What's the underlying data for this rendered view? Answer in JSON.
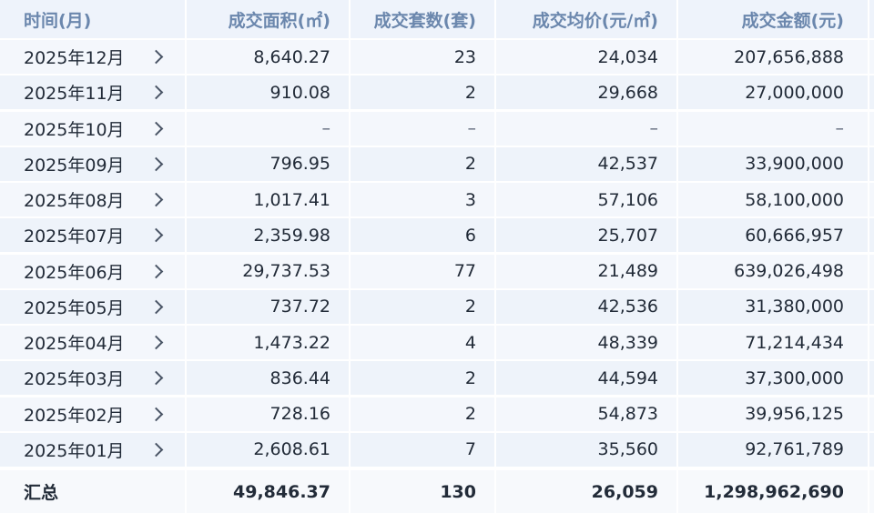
{
  "table": {
    "headers": [
      "时间(月)",
      "成交面积(㎡)",
      "成交套数(套)",
      "成交均价(元/㎡)",
      "成交金额(元)"
    ],
    "rows": [
      [
        "2025年12月",
        "8,640.27",
        "23",
        "24,034",
        "207,656,888"
      ],
      [
        "2025年11月",
        "910.08",
        "2",
        "29,668",
        "27,000,000"
      ],
      [
        "2025年10月",
        "–",
        "–",
        "–",
        "–"
      ],
      [
        "2025年09月",
        "796.95",
        "2",
        "42,537",
        "33,900,000"
      ],
      [
        "2025年08月",
        "1,017.41",
        "3",
        "57,106",
        "58,100,000"
      ],
      [
        "2025年07月",
        "2,359.98",
        "6",
        "25,707",
        "60,666,957"
      ],
      [
        "2025年06月",
        "29,737.53",
        "77",
        "21,489",
        "639,026,498"
      ],
      [
        "2025年05月",
        "737.72",
        "2",
        "42,536",
        "31,380,000"
      ],
      [
        "2025年04月",
        "1,473.22",
        "4",
        "48,339",
        "71,214,434"
      ],
      [
        "2025年03月",
        "836.44",
        "2",
        "44,594",
        "37,300,000"
      ],
      [
        "2025年02月",
        "728.16",
        "2",
        "54,873",
        "39,956,125"
      ],
      [
        "2025年01月",
        "2,608.61",
        "7",
        "35,560",
        "92,761,789"
      ]
    ],
    "total": [
      "汇总",
      "49,846.37",
      "130",
      "26,059",
      "1,298,962,690"
    ],
    "expand_icon": "chevron-right-icon"
  }
}
